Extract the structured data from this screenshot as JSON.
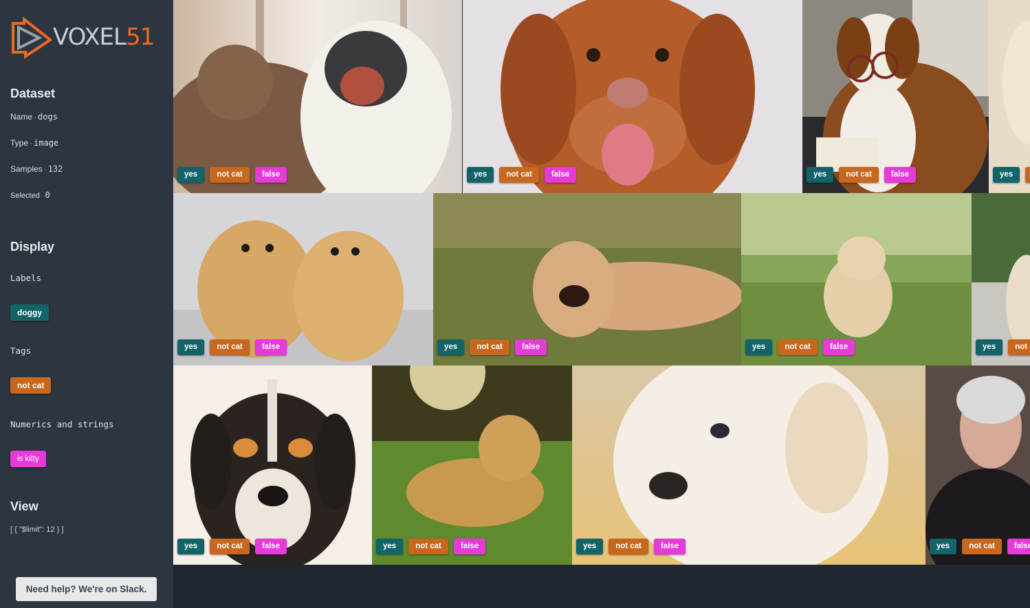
{
  "logo": {
    "text": "VOXEL",
    "num": "51",
    "icon": "play-triangle-logo-icon"
  },
  "dataset": {
    "title": "Dataset",
    "rows": [
      {
        "label": "Name",
        "value": "dogs"
      },
      {
        "label": "Type",
        "value": "image"
      },
      {
        "label": "Samples",
        "value": "132"
      },
      {
        "label": "Selected",
        "value": "0"
      }
    ]
  },
  "display": {
    "title": "Display",
    "labels_heading": "Labels",
    "labels_pill": "doggy",
    "tags_heading": "Tags",
    "tags_pill": "not cat",
    "numerics_heading": "Numerics and strings",
    "numerics_pill": "is kitty"
  },
  "view": {
    "title": "View",
    "text": "[ { \"$limit\": 12 } ]"
  },
  "help_button": "Need help? We're on Slack.",
  "colors": {
    "label_pill": "#126468",
    "tag_pill": "#c8671e",
    "numeric_pill": "#e63ad9",
    "brand_orange": "#ef6a21",
    "sidebar_bg": "#2c3540"
  },
  "tag_texts": {
    "label": "yes",
    "tag": "not cat",
    "numeric": "false"
  },
  "samples": [
    {
      "name": "two dogs hugging"
    },
    {
      "name": "smiling retriever"
    },
    {
      "name": "dog with glasses"
    },
    {
      "name": "partial dog"
    },
    {
      "name": "two pomeranians"
    },
    {
      "name": "dog lying on leaves"
    },
    {
      "name": "puppy sitting in grass"
    },
    {
      "name": "partial dog"
    },
    {
      "name": "tricolor puppy"
    },
    {
      "name": "golden retriever in grass"
    },
    {
      "name": "white puppy closeup"
    },
    {
      "name": "person smiling"
    }
  ]
}
